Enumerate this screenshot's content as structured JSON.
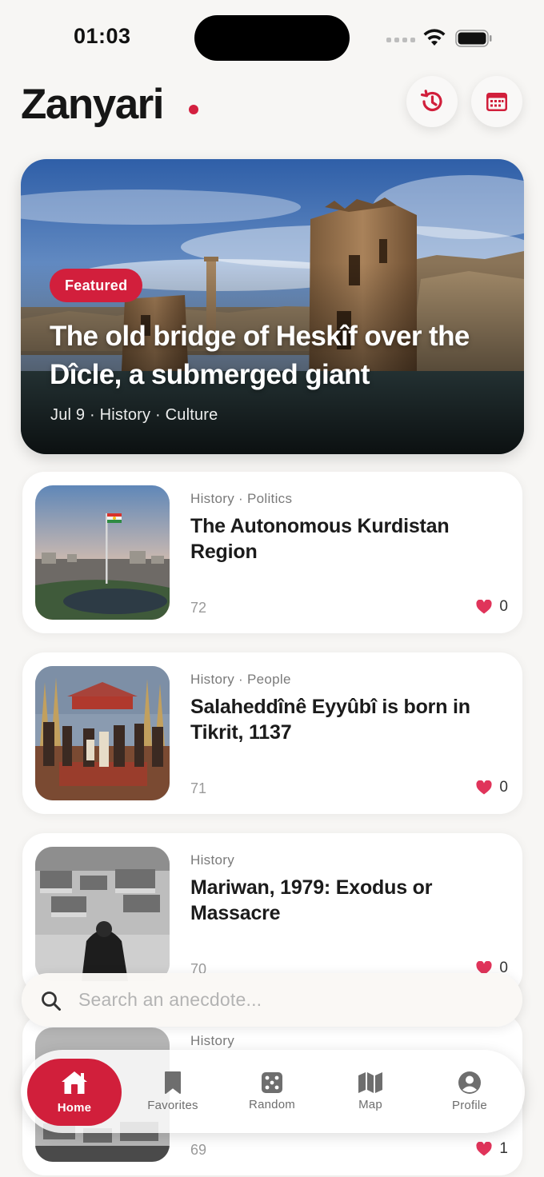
{
  "status": {
    "time": "01:03"
  },
  "header": {
    "title": "Zanyari"
  },
  "featured": {
    "badge": "Featured",
    "title": "The old bridge of Heskîf over the Dîcle, a submerged giant",
    "meta": "Jul 9 · History · Culture"
  },
  "articles": [
    {
      "category": "History · Politics",
      "title": "The Autonomous Kurdistan Region",
      "count": "72",
      "likes": "0"
    },
    {
      "category": "History · People",
      "title": "Salaheddînê Eyyûbî is born in Tikrit, 1137",
      "count": "71",
      "likes": "0"
    },
    {
      "category": "History",
      "title": "Mariwan, 1979: Exodus or Massacre",
      "count": "70",
      "likes": "0"
    },
    {
      "category": "History",
      "title": "",
      "count": "69",
      "likes": "1"
    }
  ],
  "search": {
    "placeholder": "Search an anecdote..."
  },
  "tabs": [
    {
      "label": "Home",
      "icon": "home-icon",
      "active": true
    },
    {
      "label": "Favorites",
      "icon": "bookmark-icon"
    },
    {
      "label": "Random",
      "icon": "dice-icon"
    },
    {
      "label": "Map",
      "icon": "map-icon"
    },
    {
      "label": "Profile",
      "icon": "profile-icon"
    }
  ],
  "colors": {
    "accent": "#d11f3b",
    "background": "#f7f6f4"
  }
}
